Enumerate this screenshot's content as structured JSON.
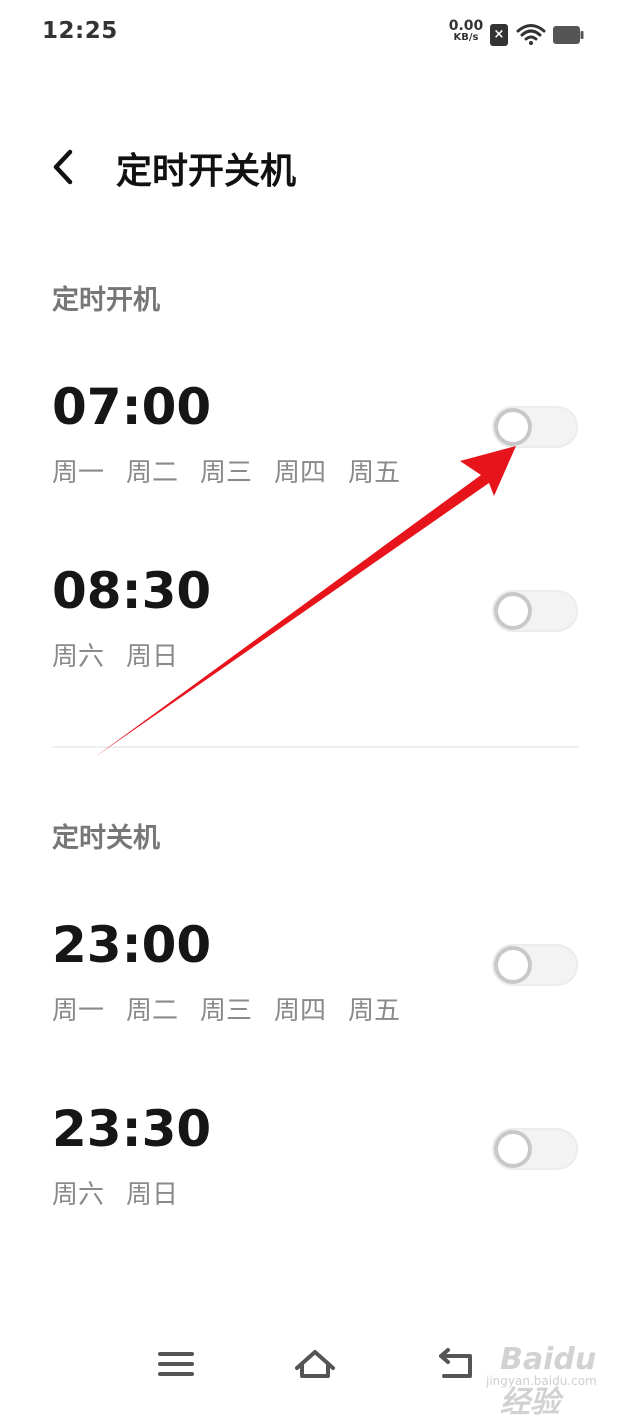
{
  "status_bar": {
    "time": "12:25",
    "net_speed_value": "0.00",
    "net_speed_unit": "KB/s",
    "sim_icon": "sim-error-icon",
    "wifi_icon": "wifi-icon",
    "battery_icon": "battery-icon"
  },
  "header": {
    "back_icon": "chevron-left-icon",
    "title": "定时开关机"
  },
  "power_on": {
    "title": "定时开机",
    "items": [
      {
        "time": "07:00",
        "days": [
          "周一",
          "周二",
          "周三",
          "周四",
          "周五"
        ],
        "enabled": false
      },
      {
        "time": "08:30",
        "days": [
          "周六",
          "周日"
        ],
        "enabled": false
      }
    ]
  },
  "power_off": {
    "title": "定时关机",
    "items": [
      {
        "time": "23:00",
        "days": [
          "周一",
          "周二",
          "周三",
          "周四",
          "周五"
        ],
        "enabled": false
      },
      {
        "time": "23:30",
        "days": [
          "周六",
          "周日"
        ],
        "enabled": false
      }
    ]
  },
  "annotation": {
    "color": "#e8141b"
  },
  "nav_bar": {
    "menu_icon": "menu-icon",
    "home_icon": "home-icon",
    "back_icon": "back-icon"
  },
  "watermark": {
    "text": "Baidu经验",
    "sub": "jingyan.baidu.com"
  }
}
